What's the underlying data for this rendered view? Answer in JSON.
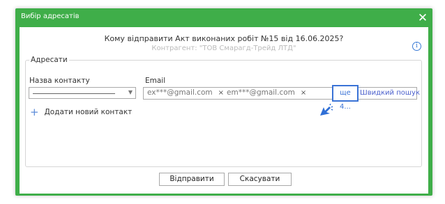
{
  "dialog": {
    "title": "Вибір адресатів",
    "close_symbol": "✕",
    "question": "Кому відправити Акт виконаних робіт №15 від 16.06.2025?",
    "counterparty": "Контрагент: \"ТОВ Смарагд-Трейд ЛТД\"",
    "info_icon": "i"
  },
  "recipients": {
    "legend": "Адресати",
    "contact_label": "Назва контакту",
    "email_label": "Email",
    "emails": [
      {
        "address": "ex***@gmail.com",
        "remove": "×"
      },
      {
        "address": "em***@gmail.com",
        "remove": "×"
      }
    ],
    "more_label": "ще 4...",
    "quick_search_label": "Швидкий пошук",
    "add_contact_label": "Додати новий контакт",
    "add_icon": "+"
  },
  "footer": {
    "send_label": "Відправити",
    "cancel_label": "Скасувати"
  },
  "colors": {
    "frame_green": "#3fae49",
    "highlight_blue": "#3a73d6",
    "link_blue": "#4a5fcc"
  }
}
